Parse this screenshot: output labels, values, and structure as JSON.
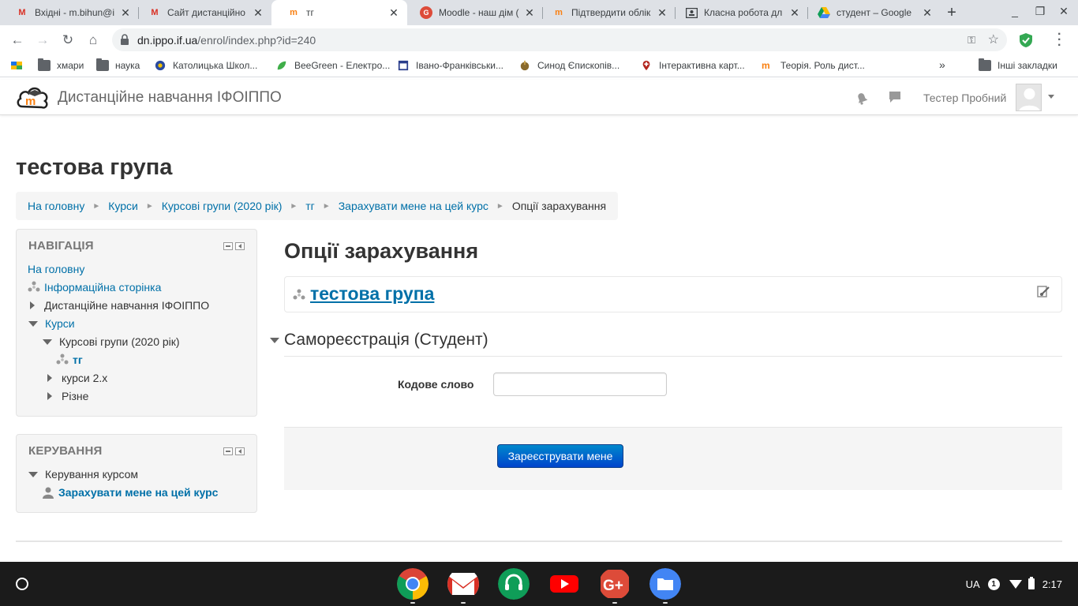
{
  "browser": {
    "tabs": [
      {
        "label": "Вхідні - m.bihun@i",
        "icon": "gmail-icon"
      },
      {
        "label": "Сайт дистанційно",
        "icon": "gmail-icon"
      },
      {
        "label": "тг",
        "icon": "moodle-icon"
      },
      {
        "label": "Moodle - наш дім (",
        "icon": "google-plus-icon"
      },
      {
        "label": "Підтвердити облік",
        "icon": "moodle-icon"
      },
      {
        "label": "Класна робота дл",
        "icon": "classroom-icon"
      },
      {
        "label": "студент – Google ",
        "icon": "google-drive-icon"
      }
    ],
    "url_host": "dn.ippo.if.ua",
    "url_path": "/enrol/index.php?id=240",
    "bookmarks": [
      {
        "label": "хмари",
        "icon": "folder-icon"
      },
      {
        "label": "наука",
        "icon": "folder-icon"
      },
      {
        "label": "Католицька Школ...",
        "icon": "school-icon"
      },
      {
        "label": "BeeGreen - Електро...",
        "icon": "beegreen-icon"
      },
      {
        "label": "Івано-Франківськи...",
        "icon": "calendar-icon"
      },
      {
        "label": "Синод Єпископів...",
        "icon": "synod-icon"
      },
      {
        "label": "Інтерактивна карт...",
        "icon": "map-pin-icon"
      },
      {
        "label": "Теорія. Роль дист...",
        "icon": "moodle-icon"
      }
    ],
    "bookmarks_overflow": "»",
    "other_bookmarks": "Інші закладки"
  },
  "moodle": {
    "site_name": "Дистанційне навчання ІФОІППО",
    "user_name": "Тестер Пробний",
    "page_title": "тестова група",
    "breadcrumb": [
      "На головну",
      "Курси",
      "Курсові групи (2020 рік)",
      "тг",
      "Зарахувати мене на цей курс",
      "Опції зарахування"
    ],
    "nav_block": {
      "title": "НАВІГАЦІЯ",
      "home": "На головну",
      "info_page": "Інформаційна сторінка",
      "site_node": "Дистанційне навчання ІФОІППО",
      "courses": "Курси",
      "course_groups": "Курсові групи (2020 рік)",
      "current_course": "тг",
      "courses_2x": "курси 2.х",
      "misc": "Різне"
    },
    "admin_block": {
      "title": "КЕРУВАННЯ",
      "course_admin": "Керування курсом",
      "enrol_me": "Зарахувати мене на цей курс"
    },
    "main": {
      "heading": "Опції зарахування",
      "course_name": "тестова група",
      "section_legend": "Самореєстрація (Студент)",
      "field_label": "Кодове слово",
      "field_value": "",
      "submit_label": "Зареєструвати мене"
    }
  },
  "os": {
    "lang": "UA",
    "notifications": "1",
    "time": "2:17"
  }
}
